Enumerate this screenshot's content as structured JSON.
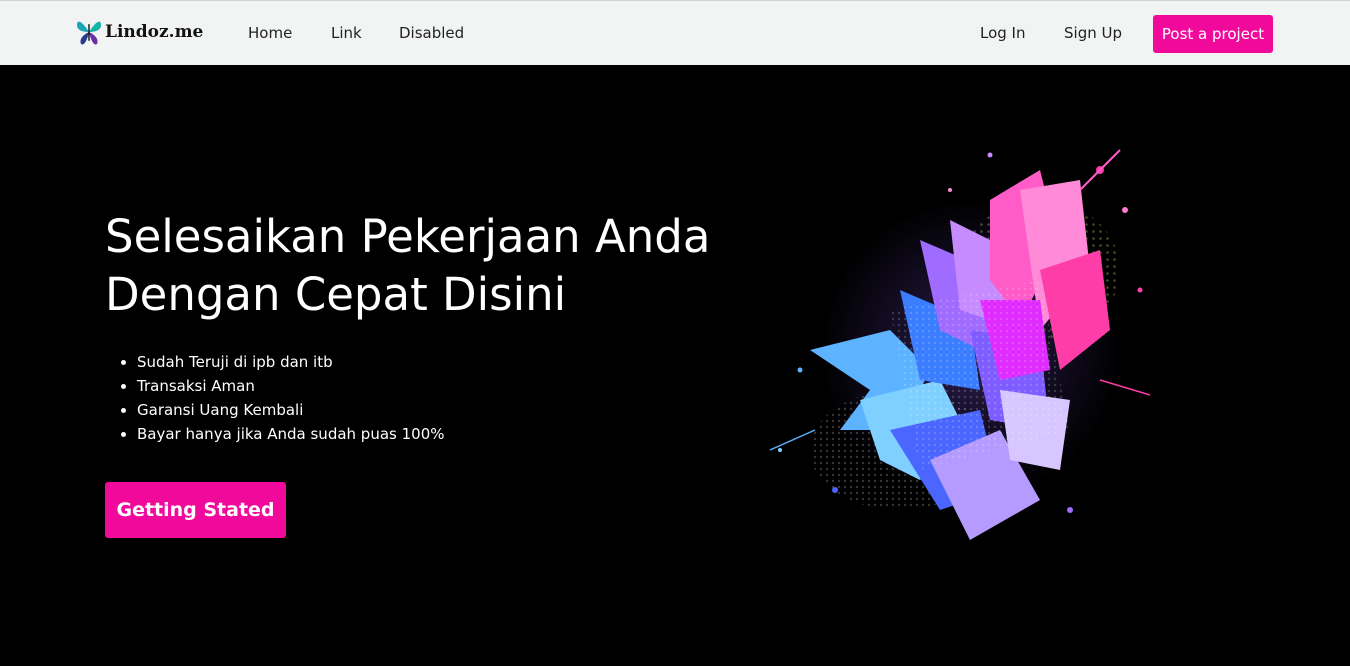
{
  "brand": {
    "name": "Lindoz.me",
    "logo_icon": "butterfly-icon"
  },
  "nav": {
    "links": [
      "Home",
      "Link",
      "Disabled"
    ],
    "login": "Log In",
    "signup": "Sign Up",
    "post_project": "Post a project"
  },
  "hero": {
    "title_line1": "Selesaikan Pekerjaan Anda",
    "title_line2": "Dengan Cepat Disini",
    "bullets": [
      "Sudah Teruji di ipb dan itb",
      "Transaksi Aman",
      "Garansi Uang Kembali",
      "Bayar hanya jika Anda sudah puas 100%"
    ],
    "cta": "Getting Stated",
    "illustration": "paint-splash-leaves"
  },
  "colors": {
    "accent": "#f0099a",
    "navbar_bg": "#f2f4f4",
    "hero_bg": "#000000",
    "text_light": "#ffffff"
  }
}
